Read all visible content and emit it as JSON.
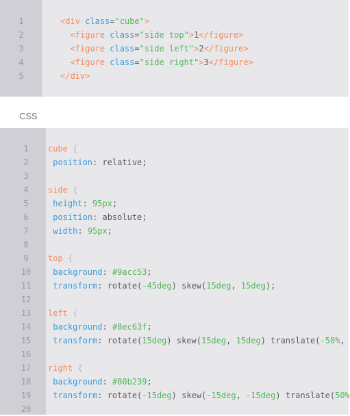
{
  "html_panel": {
    "lines": [
      [
        [
          "t-tag",
          "<div "
        ],
        [
          "t-attr",
          "class"
        ],
        [
          "t-txt",
          "="
        ],
        [
          "t-str",
          "\"cube\""
        ],
        [
          "t-tag",
          ">"
        ]
      ],
      [
        [
          "t-tag",
          "  <figure "
        ],
        [
          "t-attr",
          "class"
        ],
        [
          "t-txt",
          "="
        ],
        [
          "t-str",
          "\"side top\""
        ],
        [
          "t-tag",
          ">"
        ],
        [
          "t-txt",
          "1"
        ],
        [
          "t-tag",
          "</figure>"
        ]
      ],
      [
        [
          "t-tag",
          "  <figure "
        ],
        [
          "t-attr",
          "class"
        ],
        [
          "t-txt",
          "="
        ],
        [
          "t-str",
          "\"side left\""
        ],
        [
          "t-tag",
          ">"
        ],
        [
          "t-txt",
          "2"
        ],
        [
          "t-tag",
          "</figure>"
        ]
      ],
      [
        [
          "t-tag",
          "  <figure "
        ],
        [
          "t-attr",
          "class"
        ],
        [
          "t-txt",
          "="
        ],
        [
          "t-str",
          "\"side right\""
        ],
        [
          "t-tag",
          ">"
        ],
        [
          "t-txt",
          "3"
        ],
        [
          "t-tag",
          "</figure>"
        ]
      ],
      [
        [
          "t-tag",
          "</div>"
        ]
      ]
    ]
  },
  "css_label": "CSS",
  "css_panel": {
    "lines": [
      [
        [
          "t-sel",
          "cube "
        ],
        [
          "t-br",
          "{"
        ]
      ],
      [
        [
          "t-prop",
          " position"
        ],
        [
          "t-val",
          ": relative;"
        ]
      ],
      [],
      [
        [
          "t-sel",
          "side "
        ],
        [
          "t-br",
          "{"
        ]
      ],
      [
        [
          "t-prop",
          " height"
        ],
        [
          "t-val",
          ": "
        ],
        [
          "t-num",
          "95px"
        ],
        [
          "t-val",
          ";"
        ]
      ],
      [
        [
          "t-prop",
          " position"
        ],
        [
          "t-val",
          ": absolute;"
        ]
      ],
      [
        [
          "t-prop",
          " width"
        ],
        [
          "t-val",
          ": "
        ],
        [
          "t-num",
          "95px"
        ],
        [
          "t-val",
          ";"
        ]
      ],
      [],
      [
        [
          "t-sel",
          "top "
        ],
        [
          "t-br",
          "{"
        ]
      ],
      [
        [
          "t-prop",
          " background"
        ],
        [
          "t-val",
          ": "
        ],
        [
          "t-num",
          "#9acc53"
        ],
        [
          "t-val",
          ";"
        ]
      ],
      [
        [
          "t-prop",
          " transform"
        ],
        [
          "t-val",
          ": rotate("
        ],
        [
          "t-num",
          "-45deg"
        ],
        [
          "t-val",
          ") skew("
        ],
        [
          "t-num",
          "15deg"
        ],
        [
          "t-val",
          ", "
        ],
        [
          "t-num",
          "15deg"
        ],
        [
          "t-val",
          ");"
        ]
      ],
      [],
      [
        [
          "t-sel",
          "left "
        ],
        [
          "t-br",
          "{"
        ]
      ],
      [
        [
          "t-prop",
          " background"
        ],
        [
          "t-val",
          ": "
        ],
        [
          "t-num",
          "#8ec63f"
        ],
        [
          "t-val",
          ";"
        ]
      ],
      [
        [
          "t-prop",
          " transform"
        ],
        [
          "t-val",
          ": rotate("
        ],
        [
          "t-num",
          "15deg"
        ],
        [
          "t-val",
          ") skew("
        ],
        [
          "t-num",
          "15deg"
        ],
        [
          "t-val",
          ", "
        ],
        [
          "t-num",
          "15deg"
        ],
        [
          "t-val",
          ") translate("
        ],
        [
          "t-num",
          "-50%"
        ],
        [
          "t-val",
          ","
        ]
      ],
      [],
      [
        [
          "t-sel",
          "right "
        ],
        [
          "t-br",
          "{"
        ]
      ],
      [
        [
          "t-prop",
          " background"
        ],
        [
          "t-val",
          ": "
        ],
        [
          "t-num",
          "#80b239"
        ],
        [
          "t-val",
          ";"
        ]
      ],
      [
        [
          "t-prop",
          " transform"
        ],
        [
          "t-val",
          ": rotate("
        ],
        [
          "t-num",
          "-15deg"
        ],
        [
          "t-val",
          ") skew("
        ],
        [
          "t-num",
          "-15deg"
        ],
        [
          "t-val",
          ", "
        ],
        [
          "t-num",
          "-15deg"
        ],
        [
          "t-val",
          ") translate("
        ],
        [
          "t-num",
          "50%"
        ]
      ],
      []
    ]
  }
}
